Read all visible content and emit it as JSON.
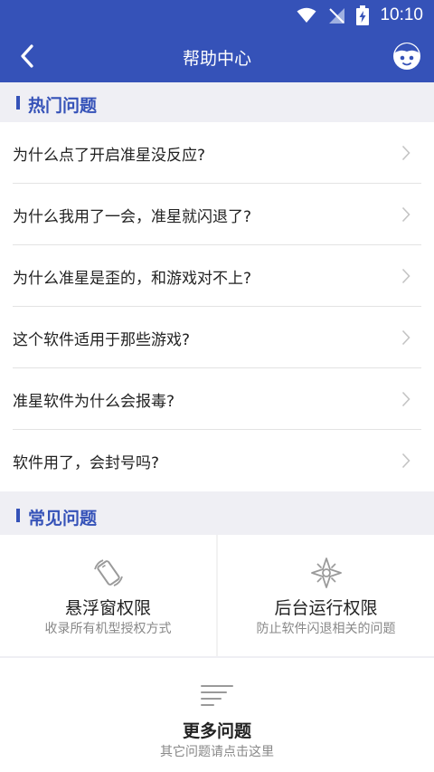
{
  "status_bar": {
    "time": "10:10",
    "icons": [
      "wifi-icon",
      "no-signal-icon",
      "battery-charging-icon"
    ]
  },
  "app_bar": {
    "title": "帮助中心",
    "back_icon": "chevron-left-icon",
    "service_icon": "customer-service-face-icon"
  },
  "hot_section": {
    "title": "热门问题",
    "items": [
      {
        "label": "为什么点了开启准星没反应?"
      },
      {
        "label": "为什么我用了一会，准星就闪退了?"
      },
      {
        "label": "为什么准星是歪的，和游戏对不上?"
      },
      {
        "label": "这个软件适用于那些游戏?"
      },
      {
        "label": "准星软件为什么会报毒?"
      },
      {
        "label": "软件用了，会封号吗?"
      }
    ]
  },
  "common_section": {
    "title": "常见问题",
    "cards": [
      {
        "title": "悬浮窗权限",
        "subtitle": "收录所有机型授权方式",
        "icon": "phone-rotate-icon"
      },
      {
        "title": "后台运行权限",
        "subtitle": "防止软件闪退相关的问题",
        "icon": "compass-icon"
      }
    ]
  },
  "more": {
    "title": "更多问题",
    "subtitle": "其它问题请点击这里",
    "icon": "lines-list-icon"
  },
  "colors": {
    "primary": "#3552b8",
    "background": "#efeff4",
    "text": "#222222",
    "muted": "#888888"
  }
}
